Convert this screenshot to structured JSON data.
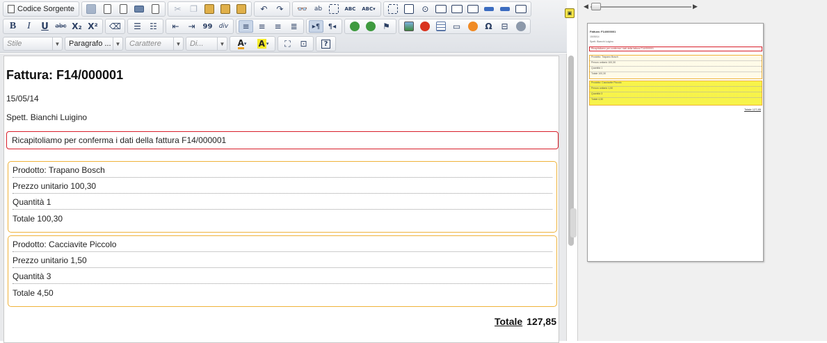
{
  "toolbar": {
    "source_label": "Codice Sorgente",
    "bold": "B",
    "italic": "I",
    "underline": "U",
    "strike": "abc",
    "subscript": "X₂",
    "superscript": "X²",
    "blockquote": "99",
    "div": "div",
    "spell1": "ABC",
    "spell2": "ABC",
    "about": "?",
    "styles_placeholder": "Stile",
    "format_value": "Paragrafo ...",
    "font_placeholder": "Carattere",
    "size_placeholder": "Di..."
  },
  "document": {
    "title": "Fattura: F14/000001",
    "date": "15/05/14",
    "recipient": "Spett. Bianchi Luigino",
    "recap": "Ricapitoliamo per conferma i dati della fattura F14/000001",
    "products": [
      {
        "product": "Prodotto: Trapano Bosch",
        "unit_price": "Prezzo unitario 100,30",
        "quantity": "Quantità 1",
        "total": "Totale 100,30"
      },
      {
        "product": "Prodotto: Cacciavite Piccolo",
        "unit_price": "Prezzo unitario 1,50",
        "quantity": "Quantità 3",
        "total": "Totale 4,50"
      }
    ],
    "grand_total_label": "Totale",
    "grand_total_value": "127,85"
  },
  "preview": {
    "title": "Fattura: F14/000001",
    "date": "15/05/14",
    "recipient": "Spett. Bianchi Luigino",
    "recap": "Ricapitoliamo per conferma i dati della fattura F14/000001",
    "p1": [
      "Prodotto: Trapano Bosch",
      "Prezzo unitario 100,30",
      "Quantità 1",
      "Totale 100,30"
    ],
    "p2": [
      "Prodotto: Cacciavite Piccolo",
      "Prezzo unitario 1,50",
      "Quantità 3",
      "Totale 4,50"
    ],
    "total": "Totale 127,85"
  },
  "colors": {
    "recap_border": "#d81f2a",
    "product_border": "#efb23a",
    "preview_highlight": "#f7f34a"
  }
}
